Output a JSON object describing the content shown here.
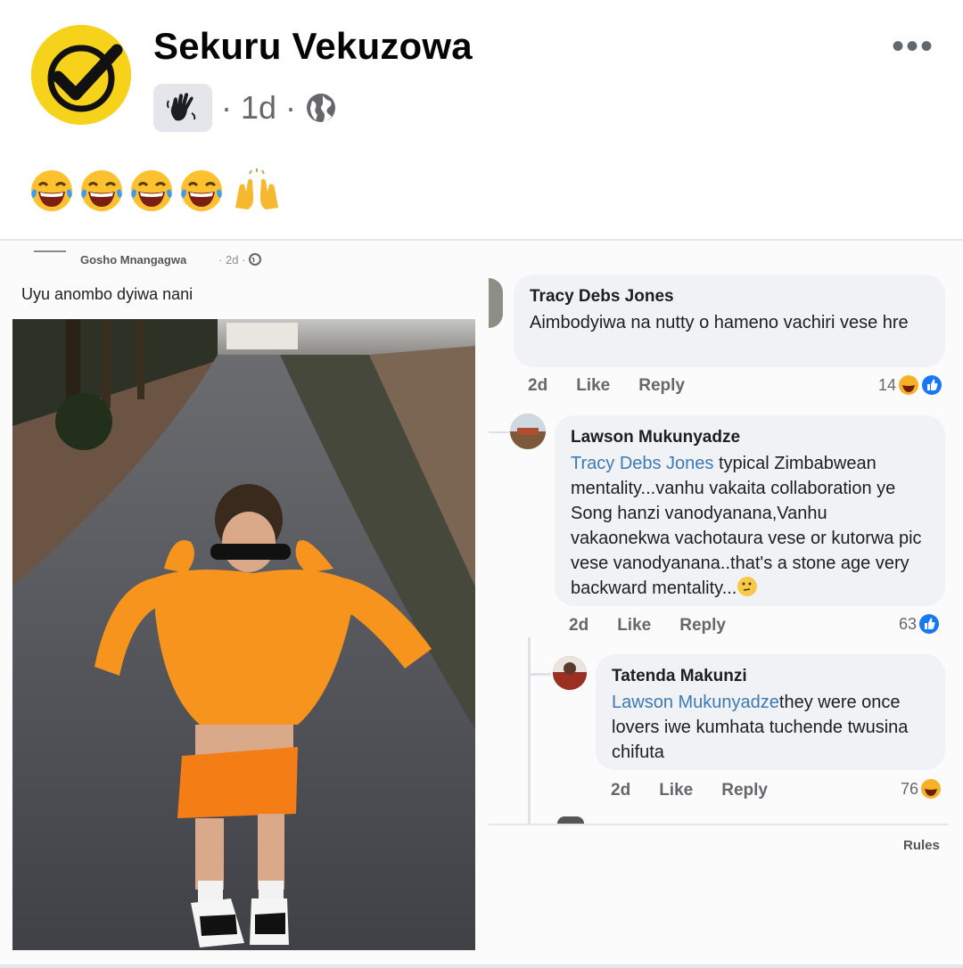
{
  "post": {
    "author": "Sekuru Vekuzowa",
    "time": "1d",
    "separator": "·",
    "more": "•••",
    "caption_emojis": [
      "laughing-tears-emoji",
      "laughing-tears-emoji",
      "laughing-tears-emoji",
      "laughing-tears-emoji",
      "raising-hands-emoji"
    ]
  },
  "inner": {
    "poster": "Gosho Mnangagwa",
    "time": "2d",
    "separator": "·",
    "caption": "Uyu anombo dyiwa nani",
    "rules": "Rules"
  },
  "comments": [
    {
      "name": "Tracy Debs Jones",
      "text": "Aimbodyiwa na nutty o hameno vachiri vese hre",
      "time": "2d",
      "like": "Like",
      "reply": "Reply",
      "reactions": "14"
    },
    {
      "name": "Lawson Mukunyadze",
      "mention": "Tracy Debs Jones",
      "text": " typical Zimbabwean mentality...vanhu vakaita collaboration ye Song hanzi vanodyanana,Vanhu vakaonekwa vachotaura vese or kutorwa pic vese vanodyanana..that's a stone age very backward mentality...",
      "time": "2d",
      "like": "Like",
      "reply": "Reply",
      "reactions": "63"
    },
    {
      "name": "Tatenda Makunzi",
      "mention": "Lawson Mukunyadze",
      "text": "they were once lovers iwe kumhata tuchende twusina chifuta",
      "time": "2d",
      "like": "Like",
      "reply": "Reply",
      "reactions": "76"
    }
  ],
  "colors": {
    "mention": "#3d7ab3",
    "badge_yellow": "#f7d21b",
    "like_blue": "#1877f2"
  }
}
